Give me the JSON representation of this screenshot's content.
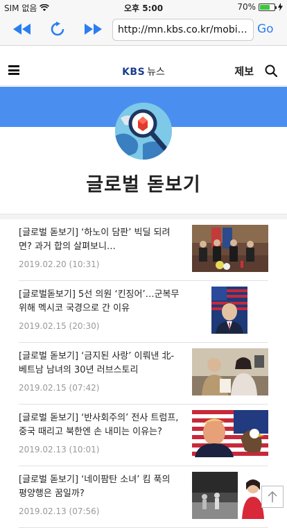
{
  "status_bar": {
    "carrier": "SIM 없음",
    "time": "오후 5:00",
    "battery": "70%",
    "battery_level": 0.7,
    "icons": [
      "wifi-icon",
      "battery-icon",
      "charging-icon"
    ]
  },
  "browser": {
    "url": "http://mn.kbs.co.kr/mobile/...",
    "go_label": "Go",
    "icons": [
      "back-icon",
      "reload-icon",
      "forward-icon"
    ]
  },
  "header": {
    "logo_kbs": "KBS",
    "logo_news": "뉴스",
    "report_label": "제보",
    "icons": [
      "menu-icon",
      "search-icon"
    ]
  },
  "hero": {
    "title": "글로벌 돋보기",
    "icon": "globe-magnifier-icon"
  },
  "colors": {
    "accent_band": "#4a8ff0",
    "link_blue": "#2a7ef0",
    "date_gray": "#999999"
  },
  "articles": [
    {
      "title": "[글로벌 돋보기] ‘하노이 담판’ 빅딜 되려면? 과거 합의 살펴보니…",
      "date": "2019.02.20 (10:31)"
    },
    {
      "title": "[글로벌돋보기] 5선 의원 ‘킨징어’…군복무 위해 멕시코 국경으로 간 이유",
      "date": "2019.02.15 (20:30)"
    },
    {
      "title": "[글로벌 돋보기] ‘금지된 사랑’ 이뤄낸 北-베트남 남녀의 30년 러브스토리",
      "date": "2019.02.15 (07:42)"
    },
    {
      "title": "[글로벌 돋보기] ‘반사회주의’ 전사 트럼프, 중국 때리고 북한엔 손 내미는 이유는?",
      "date": "2019.02.13 (10:01)"
    },
    {
      "title": "[글로벌 돋보기] ‘네이팜탄 소녀’ 킴 푹의 평양행은 꿈일까?",
      "date": "2019.02.13 (07:56)"
    }
  ]
}
